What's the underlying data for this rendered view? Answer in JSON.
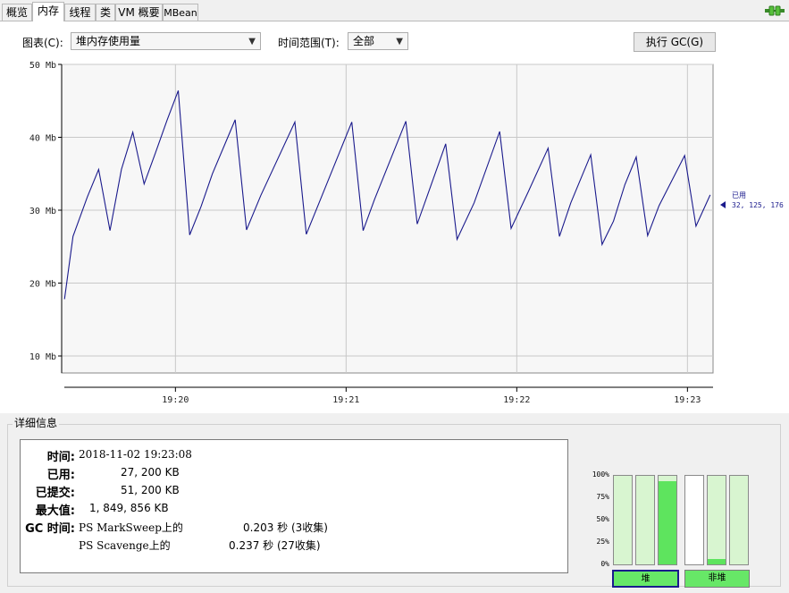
{
  "tabs": [
    {
      "label": "概览",
      "active": false
    },
    {
      "label": "内存",
      "active": true
    },
    {
      "label": "线程",
      "active": false
    },
    {
      "label": "类",
      "active": false
    },
    {
      "label": "VM 概要",
      "active": false
    },
    {
      "label": "MBean",
      "active": false
    }
  ],
  "connection_icon": "connected-plug-icon",
  "controls": {
    "chart_label": "图表(C):",
    "chart_value": "堆内存使用量",
    "range_label": "时间范围(T):",
    "range_value": "全部",
    "gc_button": "执行 GC(G)"
  },
  "chart_data": {
    "type": "line",
    "y_ticks": [
      "10 Mb",
      "20 Mb",
      "30 Mb",
      "40 Mb",
      "50 Mb"
    ],
    "ylim": [
      10,
      50
    ],
    "x_ticks": [
      "19:20",
      "19:21",
      "19:22",
      "19:23"
    ],
    "x_tick_seconds": [
      1200,
      1260,
      1320,
      1380
    ],
    "xlim_seconds": [
      1160,
      1389
    ],
    "grid": true,
    "series": [
      {
        "name": "已用",
        "color": "#1a1a8c",
        "points": [
          [
            1161,
            17.8
          ],
          [
            1164,
            26.4
          ],
          [
            1169,
            31.8
          ],
          [
            1173,
            35.6
          ],
          [
            1177,
            27.2
          ],
          [
            1181,
            35.6
          ],
          [
            1185,
            40.7
          ],
          [
            1189,
            33.6
          ],
          [
            1193,
            37.9
          ],
          [
            1197,
            42.3
          ],
          [
            1201,
            46.4
          ],
          [
            1205,
            26.6
          ],
          [
            1209,
            30.5
          ],
          [
            1213,
            35.0
          ],
          [
            1221,
            42.4
          ],
          [
            1225,
            27.3
          ],
          [
            1230,
            32.0
          ],
          [
            1242,
            42.1
          ],
          [
            1246,
            26.7
          ],
          [
            1251,
            31.5
          ],
          [
            1262,
            42.1
          ],
          [
            1266,
            27.2
          ],
          [
            1270,
            31.5
          ],
          [
            1281,
            42.2
          ],
          [
            1285,
            28.1
          ],
          [
            1289,
            32.5
          ],
          [
            1295,
            39.1
          ],
          [
            1299,
            26.0
          ],
          [
            1305,
            31.0
          ],
          [
            1314,
            40.8
          ],
          [
            1318,
            27.5
          ],
          [
            1324,
            32.5
          ],
          [
            1331,
            38.5
          ],
          [
            1335,
            26.4
          ],
          [
            1339,
            31.0
          ],
          [
            1346,
            37.6
          ],
          [
            1350,
            25.3
          ],
          [
            1354,
            28.5
          ],
          [
            1358,
            33.5
          ],
          [
            1362,
            37.3
          ],
          [
            1366,
            26.5
          ],
          [
            1370,
            30.6
          ],
          [
            1379,
            37.5
          ],
          [
            1383,
            27.8
          ],
          [
            1388,
            32.1
          ]
        ]
      }
    ],
    "current_label": "已用",
    "current_value": "32, 125, 176"
  },
  "details": {
    "title": "详细信息",
    "time_label": "时间:",
    "time_value": "2018-11-02 19:23:08",
    "used_label": "已用:",
    "used_value": "27, 200 KB",
    "committed_label": "已提交:",
    "committed_value": "51, 200 KB",
    "max_label": "最大值:",
    "max_value": "1, 849, 856 KB",
    "gc_label": "GC 时间:",
    "gc_rows": [
      {
        "name": "PS MarkSweep上的",
        "value": "0.203 秒 (3收集)"
      },
      {
        "name": "PS Scavenge上的",
        "value": "0.237 秒 (27收集)"
      }
    ]
  },
  "pools": {
    "scale": [
      "100%",
      "75%",
      "50%",
      "25%",
      "0%"
    ],
    "heap_bars": [
      0.0,
      0.0,
      0.94
    ],
    "nonheap_bars": [
      0.0,
      0.06,
      0.0
    ],
    "heap_label": "堆",
    "nonheap_label": "非堆"
  }
}
